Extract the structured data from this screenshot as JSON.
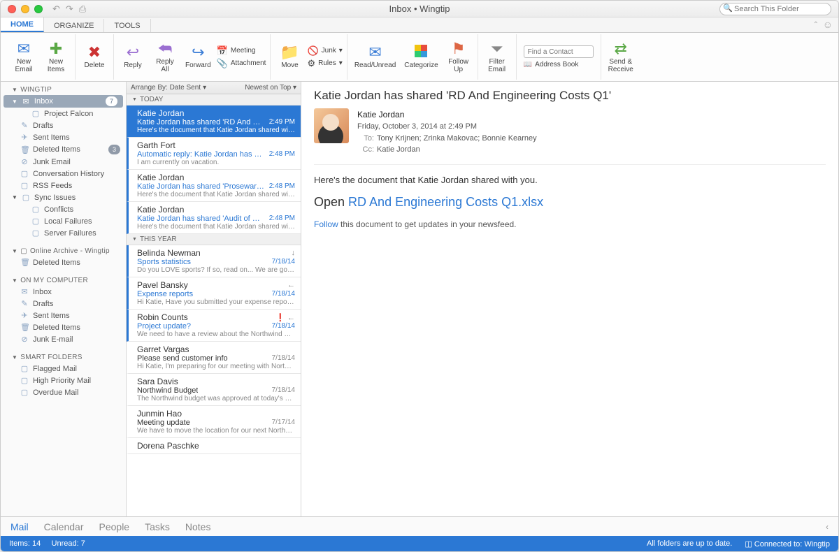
{
  "title": "Inbox • Wingtip",
  "search_placeholder": "Search This Folder",
  "tabs": {
    "home": "HOME",
    "organize": "ORGANIZE",
    "tools": "TOOLS"
  },
  "ribbon": {
    "new_email": "New\nEmail",
    "new_items": "New\nItems",
    "delete": "Delete",
    "reply": "Reply",
    "reply_all": "Reply\nAll",
    "forward": "Forward",
    "meeting": "Meeting",
    "attachment": "Attachment",
    "move": "Move",
    "junk": "Junk",
    "rules": "Rules",
    "read_unread": "Read/Unread",
    "categorize": "Categorize",
    "follow_up": "Follow\nUp",
    "filter": "Filter\nEmail",
    "find_contact_ph": "Find a Contact",
    "address_book": "Address Book",
    "send_receive": "Send &\nReceive"
  },
  "sidebar": {
    "acct": "WINGTIP",
    "inbox": "Inbox",
    "inbox_badge": "7",
    "project_falcon": "Project Falcon",
    "drafts": "Drafts",
    "sent": "Sent Items",
    "deleted": "Deleted Items",
    "deleted_badge": "3",
    "junk": "Junk Email",
    "convo": "Conversation History",
    "rss": "RSS Feeds",
    "sync": "Sync Issues",
    "conflicts": "Conflicts",
    "localfail": "Local Failures",
    "serverfail": "Server Failures",
    "archive": "Online Archive - Wingtip",
    "arch_deleted": "Deleted Items",
    "onmy": "ON MY COMPUTER",
    "omc_inbox": "Inbox",
    "omc_drafts": "Drafts",
    "omc_sent": "Sent Items",
    "omc_deleted": "Deleted Items",
    "omc_junk": "Junk E-mail",
    "smart": "SMART FOLDERS",
    "flagged": "Flagged Mail",
    "high": "High Priority Mail",
    "overdue": "Overdue Mail"
  },
  "arrange": {
    "by": "Arrange By: Date Sent",
    "sort": "Newest on Top"
  },
  "groups": {
    "today": "TODAY",
    "thisyear": "THIS YEAR"
  },
  "messages": {
    "today": [
      {
        "from": "Katie Jordan",
        "subj": "Katie Jordan has shared 'RD And Engineeri…",
        "time": "2:49 PM",
        "prev": "Here's the document that Katie Jordan shared with you…"
      },
      {
        "from": "Garth Fort",
        "subj": "Automatic reply: Katie Jordan has shared '…",
        "time": "2:48 PM",
        "prev": "I am currently on vacation."
      },
      {
        "from": "Katie Jordan",
        "subj": "Katie Jordan has shared 'Proseware Projec…",
        "time": "2:48 PM",
        "prev": "Here's the document that Katie Jordan shared with you…"
      },
      {
        "from": "Katie Jordan",
        "subj": "Katie Jordan has shared 'Audit of Small Bu…",
        "time": "2:48 PM",
        "prev": "Here's the document that Katie Jordan shared with you…"
      }
    ],
    "year": [
      {
        "from": "Belinda Newman",
        "subj": "Sports statistics",
        "time": "7/18/14",
        "prev": "Do you LOVE sports? If so, read on... We are going to…",
        "icon": "↓"
      },
      {
        "from": "Pavel Bansky",
        "subj": "Expense reports",
        "time": "7/18/14",
        "prev": "Hi Katie, Have you submitted your expense reports yet…",
        "icon": "←"
      },
      {
        "from": "Robin Counts",
        "subj": "Project update?",
        "time": "7/18/14",
        "prev": "We need to have a review about the Northwind Traders …",
        "icon": "❗ ←"
      },
      {
        "from": "Garret Vargas",
        "subj": "Please send customer info",
        "time": "7/18/14",
        "prev": "Hi Katie, I'm preparing for our meeting with Northwind,…",
        "black": true
      },
      {
        "from": "Sara Davis",
        "subj": "Northwind Budget",
        "time": "7/18/14",
        "prev": "The Northwind budget was approved at today's board…",
        "black": true
      },
      {
        "from": "Junmin Hao",
        "subj": "Meeting update",
        "time": "7/17/14",
        "prev": "We have to move the location for our next Northwind Tr…",
        "black": true
      },
      {
        "from": "Dorena Paschke",
        "subj": "",
        "time": "",
        "prev": "",
        "black": true
      }
    ]
  },
  "reader": {
    "title": "Katie Jordan has shared 'RD And Engineering Costs Q1'",
    "sender": "Katie Jordan",
    "date": "Friday, October 3, 2014 at 2:49 PM",
    "to_label": "To:",
    "to": "Tony Krijnen;   Zrinka Makovac;   Bonnie Kearney",
    "cc_label": "Cc:",
    "cc": "Katie Jordan",
    "body_line": "Here's the document that Katie Jordan shared with you.",
    "open_pre": "Open ",
    "open_link": "RD And Engineering Costs Q1.xlsx",
    "follow_link": "Follow",
    "follow_rest": " this document to get updates in your newsfeed."
  },
  "bottomnav": {
    "mail": "Mail",
    "calendar": "Calendar",
    "people": "People",
    "tasks": "Tasks",
    "notes": "Notes"
  },
  "status": {
    "left": "Items: 14     Unread: 7",
    "mid": "All folders are up to date.",
    "right": "Connected to: Wingtip"
  }
}
